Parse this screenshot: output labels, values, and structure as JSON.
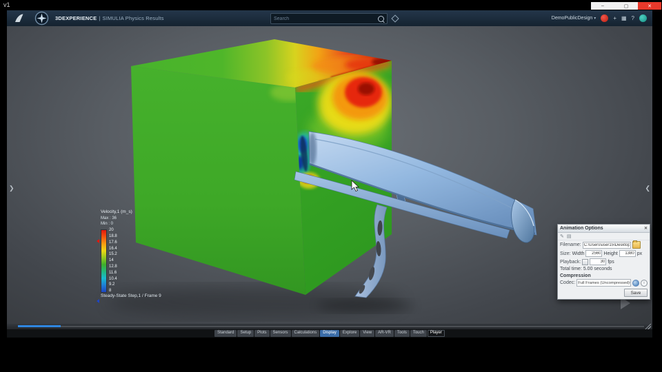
{
  "window": {
    "label": "v1"
  },
  "titlebar": {
    "minimize": "–",
    "maximize": "▢",
    "close": "✕"
  },
  "appbar": {
    "brand": "3DEXPERIENCE",
    "divider": "|",
    "app_name": "SIMULIA Physics Results",
    "search_placeholder": "Search",
    "workspace": "DemoPublicDesign"
  },
  "icons": {
    "caret_down": "▾",
    "chevron_left": "❮",
    "chevron_right": "❯",
    "pencil": "✎",
    "frames": "▤",
    "grid": "▦",
    "plus": "+",
    "help": "?",
    "close_small": "✕",
    "info": "i",
    "dropdown_caret": "▾"
  },
  "viewport": {
    "legend": {
      "title": "Velocity,1 (m_s)",
      "max": "Max : 36",
      "min": "Min : 0",
      "ticks": [
        "20",
        "18.8",
        "17.6",
        "16.4",
        "15.2",
        "14",
        "12.8",
        "11.6",
        "10.4",
        "9.2",
        "8"
      ]
    },
    "status": "Steady-State Step,1 / Frame 9"
  },
  "dialog": {
    "title": "Animation Options",
    "filename_label": "Filename:",
    "filename_value": "C:\\Users\\user15\\Desktop\\VishalFix1.avi",
    "size_label": "Size:",
    "width_label": "Width",
    "width_value": "2560",
    "height_label": "Height",
    "height_value": "1380",
    "px_label": "px",
    "playback_label": "Playback:",
    "fps_value": "30",
    "fps_label": "fps",
    "total_time": "Total time: 5.00 seconds",
    "compression": "Compression",
    "codec_label": "Codec:",
    "codec_value": "Full Frames (Uncompressed)",
    "save": "Save"
  },
  "tabs": {
    "items": [
      "Standard",
      "Setup",
      "Plots",
      "Sensors",
      "Calculations",
      "Display",
      "Explore",
      "View",
      "AR-VR",
      "Tools",
      "Touch",
      "Player"
    ],
    "active": "Player",
    "highlighted": "Display"
  },
  "colors": {
    "accent_blue": "#2f86e0",
    "cube_green": "#43b02b",
    "spoiler_blue": "#9dbfe8",
    "legend_gradient": [
      "#e2180d",
      "#f4560f",
      "#f79c12",
      "#ecd714",
      "#97c81f",
      "#3fae2c",
      "#23b77e",
      "#19b9cf",
      "#1e7fd6",
      "#1e46c4"
    ]
  }
}
